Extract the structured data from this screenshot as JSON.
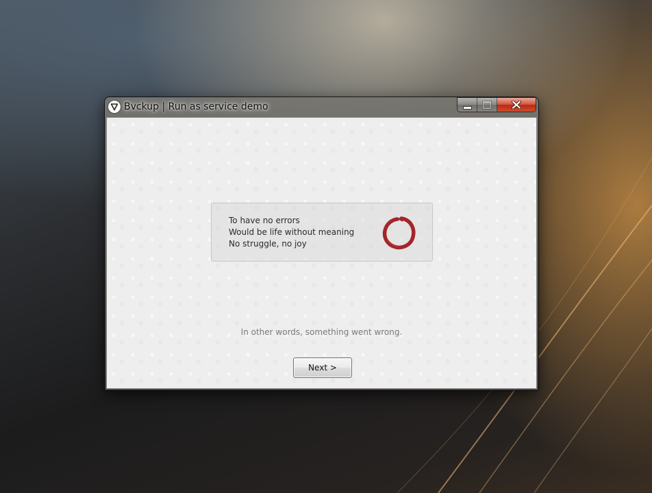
{
  "window": {
    "title": "Bvckup | Run as service demo",
    "icon": "bvckup-logo-icon",
    "controls": {
      "minimize_icon": "minimize-icon",
      "maximize_icon": "maximize-icon",
      "close_icon": "close-icon"
    }
  },
  "message": {
    "lines": [
      "To have no errors",
      "Would be life without meaning",
      "No struggle, no joy"
    ],
    "icon": "enso-circle-icon",
    "icon_color": "#a3262a"
  },
  "subtitle": "In other words, something went wrong.",
  "actions": {
    "next_label": "Next >"
  },
  "colors": {
    "close_button": "#c9422a",
    "client_background": "#eeeeee",
    "subtitle_text": "#7a7a7a"
  }
}
